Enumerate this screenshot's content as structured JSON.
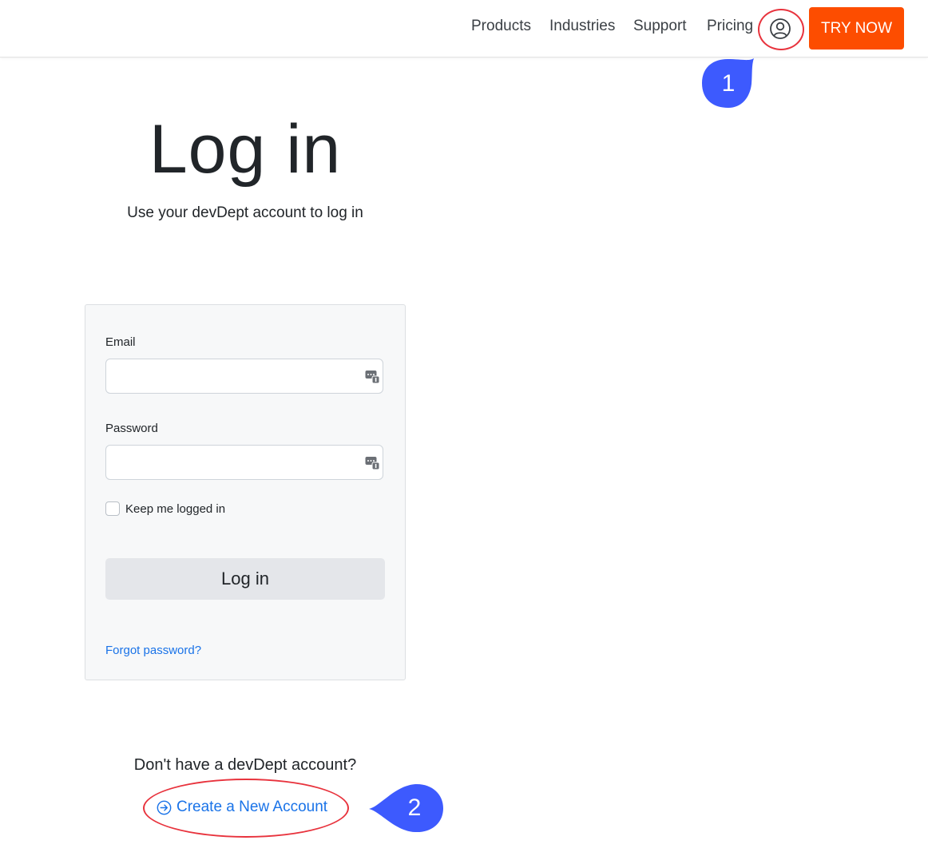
{
  "header": {
    "nav": [
      "Products",
      "Industries",
      "Support",
      "Pricing"
    ],
    "account_icon": "user-circle-icon",
    "cta_label": "TRY NOW",
    "cta_color": "#fd4d00"
  },
  "hero": {
    "title": "Log in",
    "subtitle": "Use your devDept account to log in"
  },
  "form": {
    "email_label": "Email",
    "email_value": "",
    "password_label": "Password",
    "password_value": "",
    "field_icon": "password-manager-icon",
    "remember_label": "Keep me logged in",
    "remember_checked": false,
    "submit_label": "Log in",
    "forgot_label": "Forgot password?"
  },
  "signup": {
    "prompt": "Don't have a devDept account?",
    "link_icon": "arrow-right-circle-icon",
    "link_label": "Create a New Account"
  },
  "annotations": {
    "marker_1": "1",
    "marker_2": "2",
    "marker_color": "#3d5afe",
    "ring_color": "#e8333d"
  },
  "theme": {
    "link_color": "#1a73e8",
    "card_background": "#f7f8f9"
  }
}
